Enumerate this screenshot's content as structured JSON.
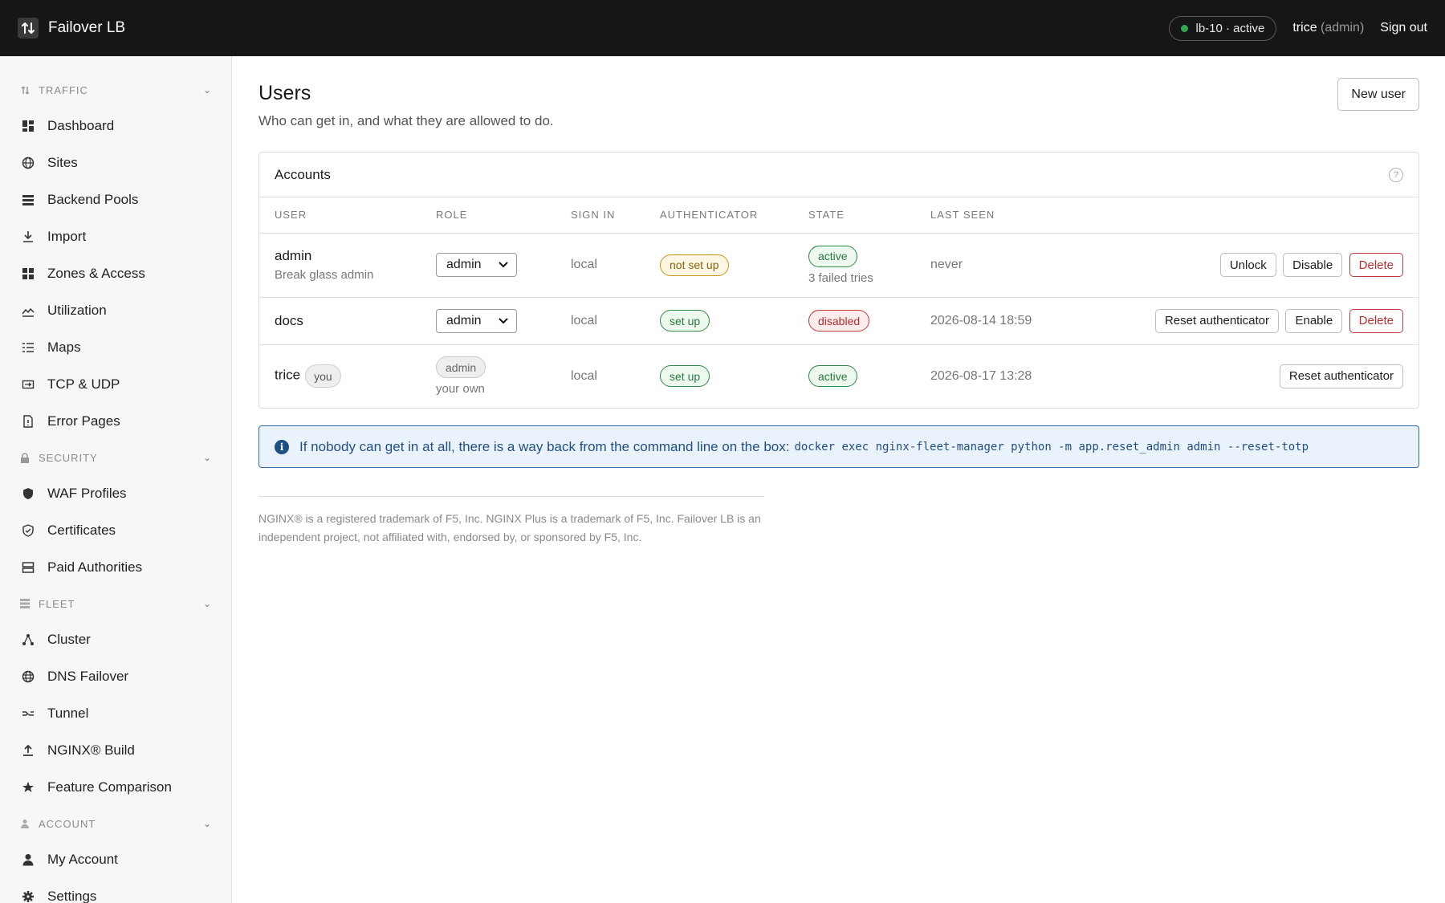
{
  "topbar": {
    "brand": "Failover LB",
    "node_status": "lb-10 · active",
    "user_name": "trice",
    "user_role": "(admin)",
    "sign_out": "Sign out"
  },
  "sidebar": {
    "groups": [
      {
        "label": "TRAFFIC",
        "icon": "updown-arrows-icon",
        "items": [
          {
            "label": "Dashboard",
            "icon": "grid-icon"
          },
          {
            "label": "Sites",
            "icon": "globe-icon"
          },
          {
            "label": "Backend Pools",
            "icon": "stack-icon"
          },
          {
            "label": "Import",
            "icon": "download-icon"
          },
          {
            "label": "Zones & Access",
            "icon": "grid-icon"
          },
          {
            "label": "Utilization",
            "icon": "line-chart-icon"
          },
          {
            "label": "Maps",
            "icon": "list-icon"
          },
          {
            "label": "TCP & UDP",
            "icon": "ports-icon"
          },
          {
            "label": "Error Pages",
            "icon": "file-icon"
          }
        ]
      },
      {
        "label": "SECURITY",
        "icon": "lock-icon",
        "items": [
          {
            "label": "WAF Profiles",
            "icon": "shield-icon"
          },
          {
            "label": "Certificates",
            "icon": "shield-check-icon"
          },
          {
            "label": "Paid Authorities",
            "icon": "server-icon"
          }
        ]
      },
      {
        "label": "FLEET",
        "icon": "fleet-icon",
        "items": [
          {
            "label": "Cluster",
            "icon": "cluster-icon"
          },
          {
            "label": "DNS Failover",
            "icon": "globe-icon"
          },
          {
            "label": "Tunnel",
            "icon": "tunnel-icon"
          },
          {
            "label": "NGINX® Build",
            "icon": "upload-icon"
          },
          {
            "label": "Feature Comparison",
            "icon": "star-icon"
          }
        ]
      },
      {
        "label": "ACCOUNT",
        "icon": "person-icon",
        "items": [
          {
            "label": "My Account",
            "icon": "person-icon"
          },
          {
            "label": "Settings",
            "icon": "gear-icon"
          }
        ]
      }
    ]
  },
  "page": {
    "title": "Users",
    "subtitle": "Who can get in, and what they are allowed to do.",
    "new_user": "New user"
  },
  "accounts": {
    "title": "Accounts",
    "help": "?",
    "columns": [
      "USER",
      "ROLE",
      "SIGN IN",
      "AUTHENTICATOR",
      "STATE",
      "LAST SEEN"
    ],
    "rows": [
      {
        "user": "admin",
        "user_sub": "Break glass admin",
        "role": "admin",
        "sign_in": "local",
        "authenticator": "not set up",
        "state": "active",
        "state_sub": "3 failed tries",
        "last_seen": "never",
        "actions": [
          "Unlock",
          "Disable",
          "Delete"
        ]
      },
      {
        "user": "docs",
        "role": "admin",
        "sign_in": "local",
        "authenticator": "set up",
        "state": "disabled",
        "last_seen": "2026-08-14 18:59",
        "actions": [
          "Reset authenticator",
          "Enable",
          "Delete"
        ]
      },
      {
        "user": "trice",
        "you": "you",
        "role": "admin",
        "role_sub": "your own",
        "sign_in": "local",
        "authenticator": "set up",
        "state": "active",
        "last_seen": "2026-08-17 13:28",
        "actions": [
          "Reset authenticator"
        ]
      }
    ]
  },
  "notice": {
    "text": "If nobody can get in at all, there is a way back from the command line on the box:",
    "command": "docker exec nginx-fleet-manager python -m app.reset_admin admin --reset-totp"
  },
  "footer": {
    "text": "NGINX® is a registered trademark of F5, Inc. NGINX Plus is a trademark of F5, Inc. Failover LB is an independent project, not affiliated with, endorsed by, or sponsored by F5, Inc."
  },
  "colors": {
    "topbar": "#161616",
    "status_green": "#2fa84f",
    "danger": "#b3302f",
    "info": "#1f4f85"
  }
}
